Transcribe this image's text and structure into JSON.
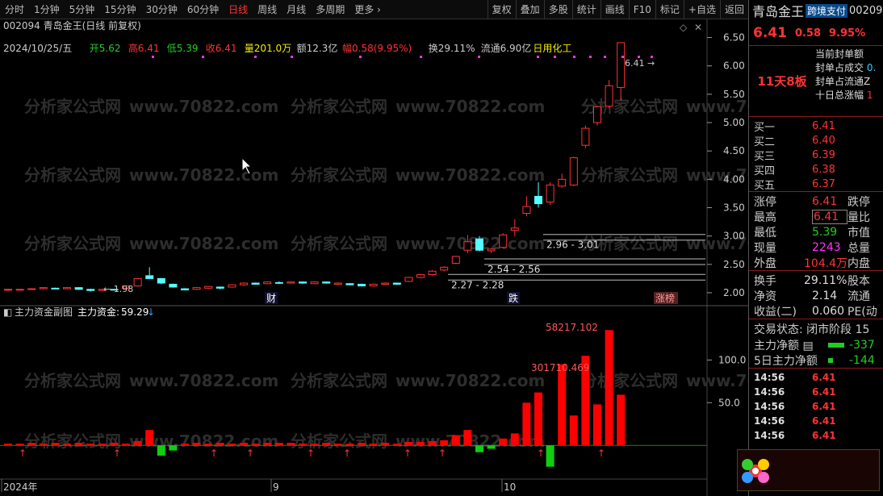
{
  "toolbar": {
    "tabs": [
      {
        "label": "分时",
        "active": false
      },
      {
        "label": "1分钟",
        "active": false
      },
      {
        "label": "5分钟",
        "active": false
      },
      {
        "label": "15分钟",
        "active": false
      },
      {
        "label": "30分钟",
        "active": false
      },
      {
        "label": "60分钟",
        "active": false
      },
      {
        "label": "日线",
        "active": true
      },
      {
        "label": "周线",
        "active": false
      },
      {
        "label": "月线",
        "active": false
      },
      {
        "label": "多周期",
        "active": false
      },
      {
        "label": "更多",
        "active": false
      }
    ],
    "actions": [
      "复权",
      "叠加",
      "多股",
      "统计",
      "画线",
      "F10",
      "标记",
      "+自选",
      "返回"
    ]
  },
  "header": {
    "title": "002094 青岛金王(日线 前复权)",
    "info": [
      {
        "t": "2024/10/25/五",
        "c": "#ccc"
      },
      {
        "t": "开5.62",
        "c": "#2c2"
      },
      {
        "t": "高6.41",
        "c": "#f33"
      },
      {
        "t": "低5.39",
        "c": "#2c2"
      },
      {
        "t": "收6.41",
        "c": "#f33"
      },
      {
        "t": "量201.0万",
        "c": "#ee0"
      },
      {
        "t": "额12.3亿",
        "c": "#ccc"
      },
      {
        "t": "幅0.58(9.95%)",
        "c": "#f33"
      },
      {
        "t": "换29.11%",
        "c": "#ccc"
      },
      {
        "t": "流通6.90亿",
        "c": "#ccc"
      },
      {
        "t": "日用化工",
        "c": "#ee0"
      }
    ]
  },
  "indicator": {
    "title": "主力资金副图",
    "label": "主力资金:",
    "value": "59.29",
    "arrow_icon": "down-arrow-icon"
  },
  "annotations": {
    "ranges": [
      "2.96 - 3.01",
      "2.54 - 2.56",
      "2.27 - 2.28"
    ],
    "low_marker": "1.98",
    "high_marker": "6.41",
    "events": [
      "财",
      "跌",
      "涨榜"
    ],
    "big_values": [
      "58217.102",
      "301710.469"
    ]
  },
  "x_axis": [
    "2024年",
    "9",
    "10"
  ],
  "watermarks": [
    "分析家公式网",
    "www.70822.com"
  ],
  "chart_data": {
    "type": "candlestick",
    "y_ticks": [
      2.0,
      2.5,
      3.0,
      3.5,
      4.0,
      4.5,
      5.0,
      5.5,
      6.0,
      6.5
    ],
    "y_range": [
      1.9,
      6.65
    ],
    "candles": [
      [
        2.05,
        2.06,
        2.03,
        2.07
      ],
      [
        2.05,
        2.06,
        2.04,
        2.07
      ],
      [
        2.06,
        2.07,
        2.05,
        2.08
      ],
      [
        2.07,
        2.09,
        2.06,
        2.1
      ],
      [
        2.08,
        2.07,
        2.06,
        2.09
      ],
      [
        2.07,
        2.09,
        2.06,
        2.1
      ],
      [
        2.09,
        2.06,
        2.05,
        2.1
      ],
      [
        2.06,
        2.04,
        2.02,
        2.07
      ],
      [
        2.04,
        2.06,
        2.03,
        2.07
      ],
      [
        2.06,
        2.05,
        2.04,
        2.07
      ],
      [
        2.08,
        2.12,
        2.07,
        2.13
      ],
      [
        2.12,
        2.25,
        2.11,
        2.26
      ],
      [
        2.3,
        2.25,
        2.24,
        2.45
      ],
      [
        2.25,
        2.17,
        2.15,
        2.26
      ],
      [
        2.15,
        2.1,
        2.09,
        2.16
      ],
      [
        2.07,
        2.05,
        2.04,
        2.08
      ],
      [
        2.06,
        2.09,
        2.05,
        2.1
      ],
      [
        2.08,
        2.11,
        2.07,
        2.12
      ],
      [
        2.1,
        2.08,
        2.06,
        2.11
      ],
      [
        2.1,
        2.14,
        2.09,
        2.15
      ],
      [
        2.14,
        2.17,
        2.12,
        2.18
      ],
      [
        2.17,
        2.15,
        2.14,
        2.18
      ],
      [
        2.16,
        2.19,
        2.15,
        2.2
      ],
      [
        2.18,
        2.17,
        2.16,
        2.2
      ],
      [
        2.17,
        2.19,
        2.16,
        2.2
      ],
      [
        2.19,
        2.17,
        2.16,
        2.2
      ],
      [
        2.16,
        2.19,
        2.15,
        2.2
      ],
      [
        2.19,
        2.17,
        2.16,
        2.2
      ],
      [
        2.15,
        2.17,
        2.14,
        2.18
      ],
      [
        2.16,
        2.14,
        2.13,
        2.17
      ],
      [
        2.15,
        2.12,
        2.11,
        2.16
      ],
      [
        2.12,
        2.15,
        2.11,
        2.16
      ],
      [
        2.15,
        2.17,
        2.14,
        2.18
      ],
      [
        2.17,
        2.15,
        2.14,
        2.18
      ],
      [
        2.2,
        2.27,
        2.19,
        2.28
      ],
      [
        2.27,
        2.32,
        2.25,
        2.33
      ],
      [
        2.32,
        2.38,
        2.3,
        2.4
      ],
      [
        2.4,
        2.45,
        2.38,
        2.47
      ],
      [
        2.52,
        2.64,
        2.5,
        2.65
      ],
      [
        2.75,
        2.9,
        2.7,
        3.02
      ],
      [
        2.95,
        2.75,
        2.73,
        3.0
      ],
      [
        2.74,
        2.77,
        2.7,
        2.78
      ],
      [
        2.8,
        3.02,
        2.78,
        3.05
      ],
      [
        3.1,
        3.14,
        3.0,
        3.3
      ],
      [
        3.4,
        3.52,
        3.35,
        3.7
      ],
      [
        3.7,
        3.57,
        3.5,
        3.95
      ],
      [
        3.6,
        3.9,
        3.55,
        3.95
      ],
      [
        3.88,
        4.0,
        3.85,
        4.1
      ],
      [
        3.9,
        4.38,
        3.88,
        4.4
      ],
      [
        4.6,
        4.9,
        4.55,
        4.95
      ],
      [
        5.0,
        5.28,
        4.95,
        5.3
      ],
      [
        5.29,
        5.65,
        5.25,
        5.75
      ],
      [
        5.62,
        6.41,
        5.39,
        6.41
      ]
    ],
    "flow": [
      2,
      2,
      3,
      2,
      3,
      2,
      3,
      2,
      2,
      3,
      2,
      5,
      18,
      -12,
      -6,
      2,
      3,
      2,
      3,
      2,
      3,
      2,
      3,
      3,
      3,
      2,
      2,
      3,
      2,
      2,
      3,
      2,
      3,
      2,
      4,
      4,
      5,
      6,
      12,
      18,
      -8,
      -4,
      8,
      14,
      50,
      62,
      -25,
      95,
      35,
      105,
      48,
      135,
      59.29
    ],
    "flow_ticks": [
      50.0,
      100.0
    ],
    "flow_range": [
      -30,
      140
    ]
  }
}
